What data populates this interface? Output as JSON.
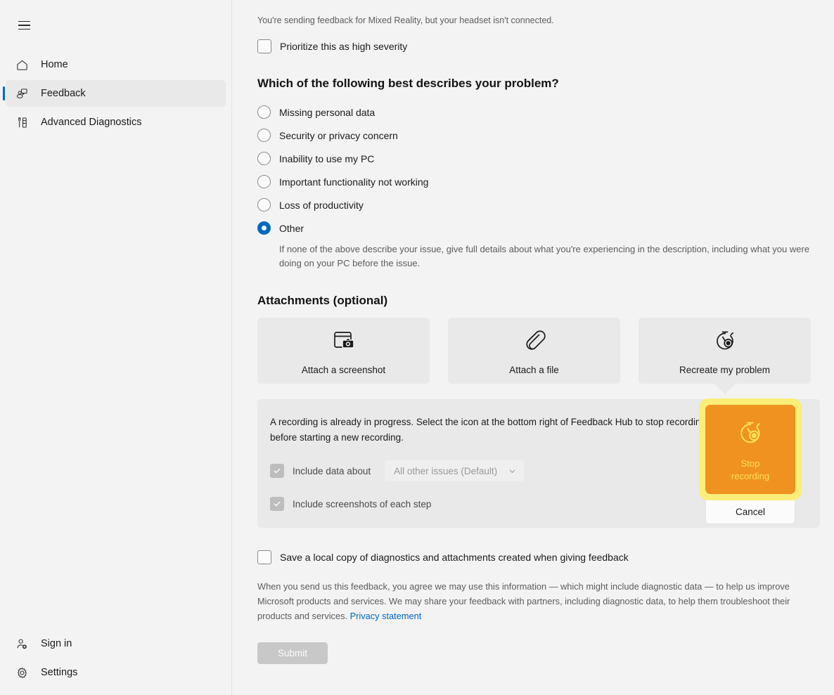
{
  "sidebar": {
    "menu_icon": "hamburger-icon",
    "top_items": [
      {
        "label": "Home",
        "icon": "home-icon",
        "selected": false
      },
      {
        "label": "Feedback",
        "icon": "feedback-icon",
        "selected": true
      },
      {
        "label": "Advanced Diagnostics",
        "icon": "diagnostics-icon",
        "selected": false
      }
    ],
    "bottom_items": [
      {
        "label": "Sign in",
        "icon": "person-add-icon"
      },
      {
        "label": "Settings",
        "icon": "gear-icon"
      }
    ]
  },
  "main": {
    "notice": "You're sending feedback for Mixed Reality, but your headset isn't connected.",
    "priority_checkbox_label": "Prioritize this as high severity",
    "problem_section_title": "Which of the following best describes your problem?",
    "problem_options": [
      {
        "label": "Missing personal data",
        "selected": false
      },
      {
        "label": "Security or privacy concern",
        "selected": false
      },
      {
        "label": "Inability to use my PC",
        "selected": false
      },
      {
        "label": "Important functionality not working",
        "selected": false
      },
      {
        "label": "Loss of productivity",
        "selected": false
      },
      {
        "label": "Other",
        "selected": true
      }
    ],
    "other_help_text": "If none of the above describe your issue, give full details about what you're experiencing in the description, including what you were doing on your PC before the issue.",
    "attachments_section_title": "Attachments (optional)",
    "attachments": [
      {
        "label": "Attach a screenshot",
        "icon": "screenshot-camera-icon"
      },
      {
        "label": "Attach a file",
        "icon": "paperclip-icon"
      },
      {
        "label": "Recreate my problem",
        "icon": "stopwatch-record-icon"
      }
    ],
    "recording_panel": {
      "message": "A recording is already in progress. Select the icon at the bottom right of Feedback Hub to stop recording before starting a new recording.",
      "include_data_label": "Include data about",
      "include_data_value": "All other issues (Default)",
      "include_screenshots_label": "Include screenshots of each step"
    },
    "stop_flyout": {
      "stop_label": "Stop\nrecording",
      "cancel_label": "Cancel",
      "icon": "stopwatch-record-icon",
      "button_color": "#f0921f",
      "glyph_color": "#fae05a",
      "highlight_color": "#faee79"
    },
    "save_local_copy_label": "Save a local copy of diagnostics and attachments created when giving feedback",
    "legal_text": "When you send us this feedback, you agree we may use this information — which might include diagnostic data — to help us improve Microsoft products and services. We may share your feedback with partners, including diagnostic data, to help them troubleshoot their products and services. ",
    "privacy_link": "Privacy statement",
    "submit_label": "Submit"
  },
  "colors": {
    "accent": "#0067c0",
    "card": "#e9e9e9",
    "page": "#f3f3f3"
  }
}
